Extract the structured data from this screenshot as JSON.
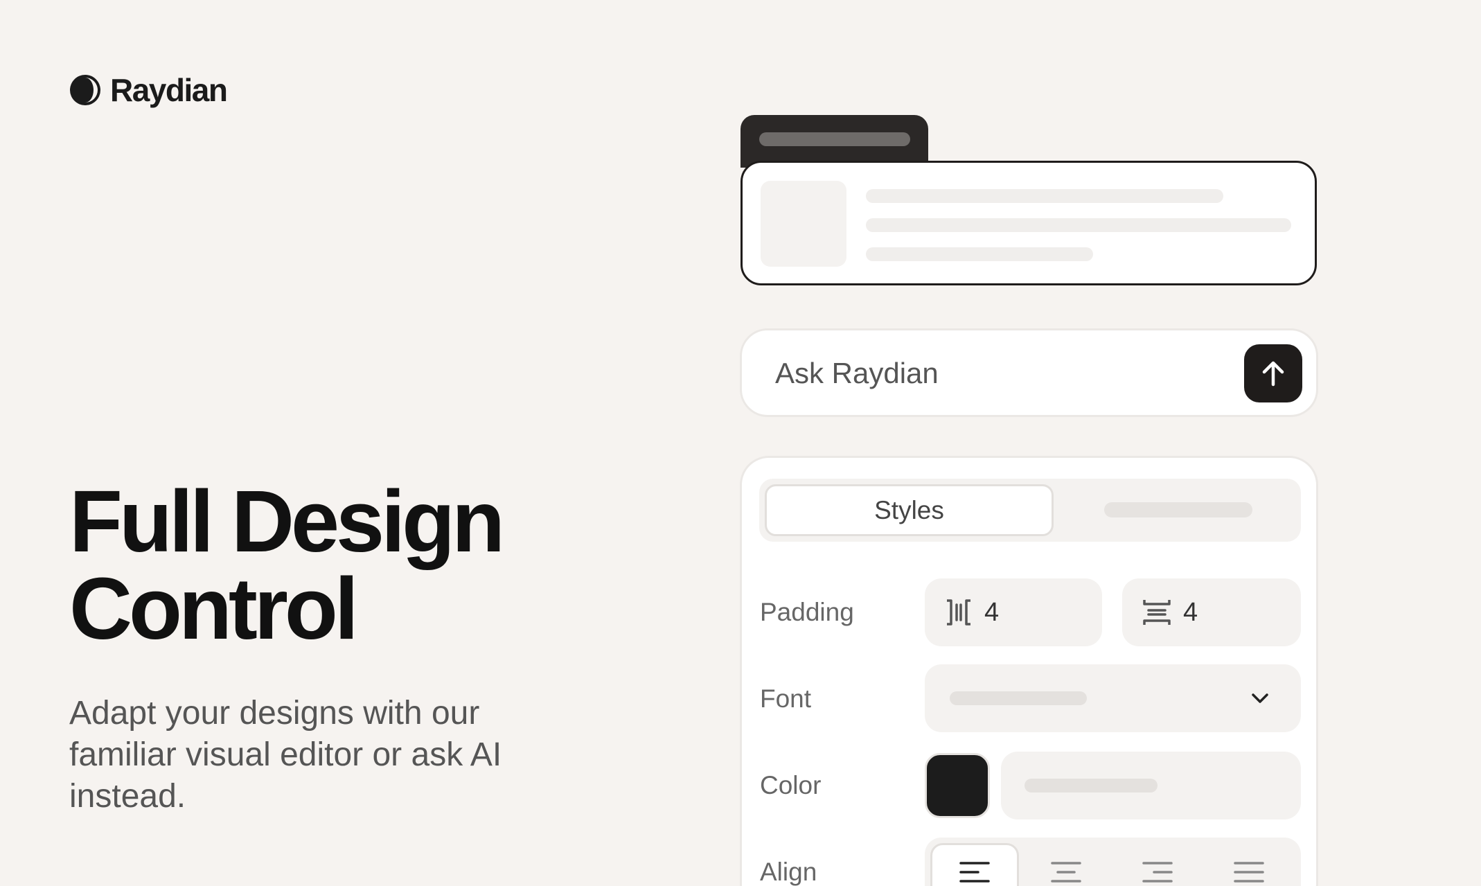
{
  "brand": {
    "name": "Raydian"
  },
  "hero": {
    "title_line1": "Full Design",
    "title_line2": "Control",
    "subtitle": "Adapt your designs with our familiar visual editor or ask AI instead."
  },
  "ask": {
    "placeholder": "Ask Raydian",
    "send_icon": "arrow-up-icon"
  },
  "editor": {
    "tabs": [
      {
        "label": "Styles",
        "active": true
      }
    ],
    "padding": {
      "label": "Padding",
      "horizontal": "4",
      "vertical": "4"
    },
    "font": {
      "label": "Font"
    },
    "color": {
      "label": "Color",
      "swatch": "#1c1c1c"
    },
    "align": {
      "label": "Align",
      "options": [
        "align-left-icon",
        "align-center-icon",
        "align-right-icon",
        "align-justify-icon"
      ],
      "selected": 0
    }
  },
  "colors": {
    "background": "#f6f3f0",
    "dark": "#1f1c1b",
    "muted": "#f4f2f0"
  }
}
